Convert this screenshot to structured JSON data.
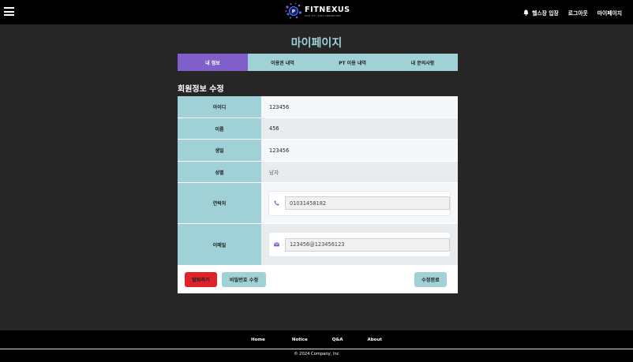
{
  "header": {
    "brand_name": "FITNEXUS",
    "brand_tagline": "STAY FIT, STAY CONNECTED",
    "nav": [
      "헬스장 입장",
      "로그아웃",
      "마이페이지"
    ]
  },
  "page_title": "마이페이지",
  "tabs": [
    "내 정보",
    "이용권 내역",
    "PT 이용 내역",
    "내 문의사항"
  ],
  "section_title": "회원정보 수정",
  "form": {
    "rows": [
      {
        "label": "아이디",
        "value": "123456"
      },
      {
        "label": "이름",
        "value": "456"
      },
      {
        "label": "생일",
        "value": "123456"
      },
      {
        "label": "성별",
        "value": "남자"
      },
      {
        "label": "연락처",
        "value": "01031458182"
      },
      {
        "label": "이메일",
        "value": "123456@123456123"
      }
    ]
  },
  "buttons": {
    "withdraw": "탈퇴하기",
    "change_password": "비밀번호 수정",
    "save": "수정완료"
  },
  "footer": {
    "links": [
      "Home",
      "Notice",
      "Q&A",
      "About"
    ],
    "copyright": "© 2024 Company, Inc"
  },
  "colors": {
    "accent_teal": "#a0d1d6",
    "active_tab_purple": "#8060c8",
    "danger_red": "#e0232b",
    "background": "#262626"
  }
}
